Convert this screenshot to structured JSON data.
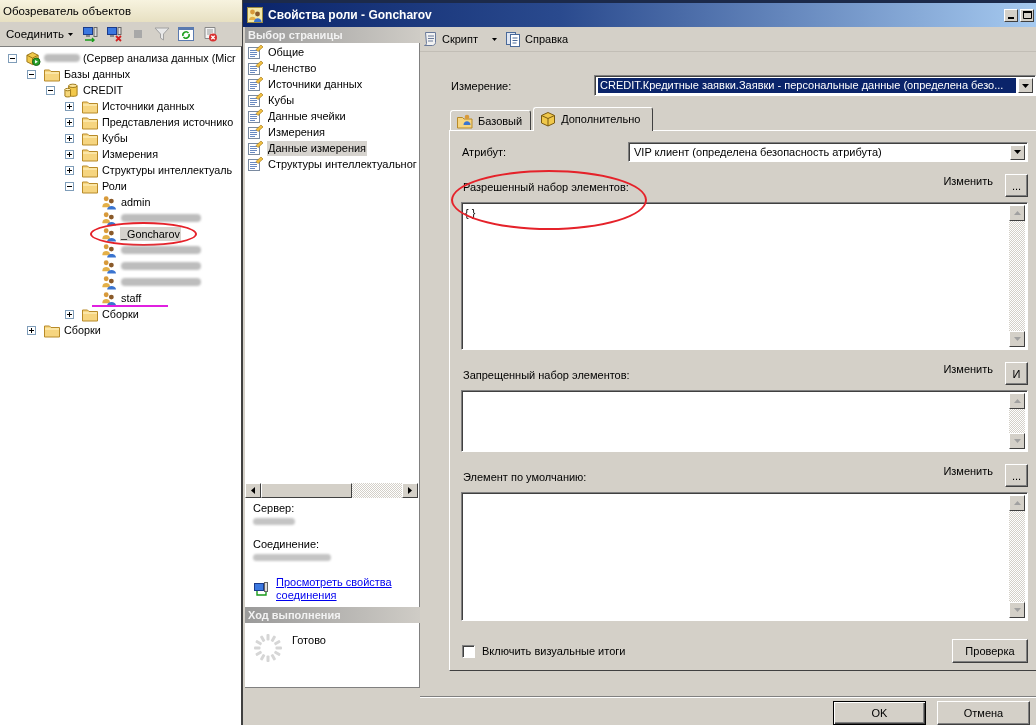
{
  "object_explorer": {
    "title": "Обозреватель объектов",
    "toolbar": {
      "connect": "Соединить"
    },
    "tree": [
      {
        "label": "(Сервер анализа данных (Micr",
        "kind": "server",
        "redacted": true,
        "expanded": true,
        "selected": false,
        "children": [
          {
            "label": "Базы данных",
            "kind": "folder",
            "expanded": true,
            "selected": false,
            "children": [
              {
                "label": "CREDIT",
                "kind": "database",
                "expanded": true,
                "selected": false,
                "children": [
                  {
                    "label": "Источники данных",
                    "kind": "folder",
                    "expanded": false,
                    "selected": false
                  },
                  {
                    "label": "Представления источнико",
                    "kind": "folder",
                    "expanded": false,
                    "selected": false
                  },
                  {
                    "label": "Кубы",
                    "kind": "folder",
                    "expanded": false,
                    "selected": false
                  },
                  {
                    "label": "Измерения",
                    "kind": "folder",
                    "expanded": false,
                    "selected": false
                  },
                  {
                    "label": "Структуры интеллектуаль",
                    "kind": "folder",
                    "expanded": false,
                    "selected": false
                  },
                  {
                    "label": "Роли",
                    "kind": "folder",
                    "expanded": true,
                    "selected": false,
                    "children": [
                      {
                        "label": "admin",
                        "kind": "role",
                        "selected": false
                      },
                      {
                        "kind": "role",
                        "redacted": true,
                        "selected": false
                      },
                      {
                        "label": "_Goncharov",
                        "kind": "role",
                        "selected": true,
                        "circled": true
                      },
                      {
                        "kind": "role",
                        "redacted": true,
                        "selected": false
                      },
                      {
                        "kind": "role",
                        "redacted": true,
                        "selected": false
                      },
                      {
                        "kind": "role",
                        "redacted": true,
                        "selected": false
                      },
                      {
                        "label": "staff",
                        "kind": "role",
                        "selected": false,
                        "underlined": true
                      }
                    ]
                  },
                  {
                    "label": "Сборки",
                    "kind": "folder",
                    "expanded": false,
                    "selected": false
                  }
                ]
              }
            ]
          },
          {
            "label": "Сборки",
            "kind": "folder",
            "expanded": false,
            "selected": false
          }
        ]
      }
    ]
  },
  "dialog": {
    "title": "Свойства роли - Goncharov",
    "page_selector": {
      "title": "Выбор страницы",
      "pages": [
        {
          "label": "Общие",
          "selected": false
        },
        {
          "label": "Членство",
          "selected": false
        },
        {
          "label": "Источники данных",
          "selected": false
        },
        {
          "label": "Кубы",
          "selected": false
        },
        {
          "label": "Данные ячейки",
          "selected": false
        },
        {
          "label": "Измерения",
          "selected": false
        },
        {
          "label": "Данные измерения",
          "selected": true
        },
        {
          "label": "Структуры интеллектуальног",
          "selected": false
        }
      ]
    },
    "connection": {
      "items": [
        {
          "label": "Сервер:",
          "redacted": true
        },
        {
          "label": "Соединение:",
          "redacted": true
        }
      ],
      "link": "Просмотреть свойства соединения"
    },
    "progress": {
      "title": "Ход выполнения",
      "status": "Готово"
    },
    "toolbar": {
      "script": "Скрипт",
      "help": "Справка"
    },
    "dimension": {
      "label": "Измерение:",
      "value": "CREDIT.Кредитные заявки.Заявки - персональные данные (определена безо...",
      "focused": true
    },
    "tabs": [
      {
        "label": "Базовый",
        "kind": "basic",
        "selected": false
      },
      {
        "label": "Дополнительно",
        "kind": "advanced",
        "selected": true
      }
    ],
    "attribute": {
      "label": "Атрибут:",
      "value": "VIP клиент (определена безопасность атрибута)",
      "focused": false
    },
    "sets": [
      {
        "label": "Разрешенный набор элементов:",
        "edit_label": "Изменить",
        "button": "...",
        "value": "{ }",
        "circled": true
      },
      {
        "label": "Запрещенный набор элементов:",
        "edit_label": "Изменить",
        "button": "И"
      },
      {
        "label": "Элемент по умолчанию:",
        "edit_label": "Изменить",
        "button": "..."
      }
    ],
    "visual_totals": {
      "label": "Включить визуальные итоги",
      "checked": false
    },
    "check_button": "Проверка",
    "buttons": [
      {
        "label": "OK",
        "default": true
      },
      {
        "label": "Отмена",
        "default": false
      }
    ]
  }
}
